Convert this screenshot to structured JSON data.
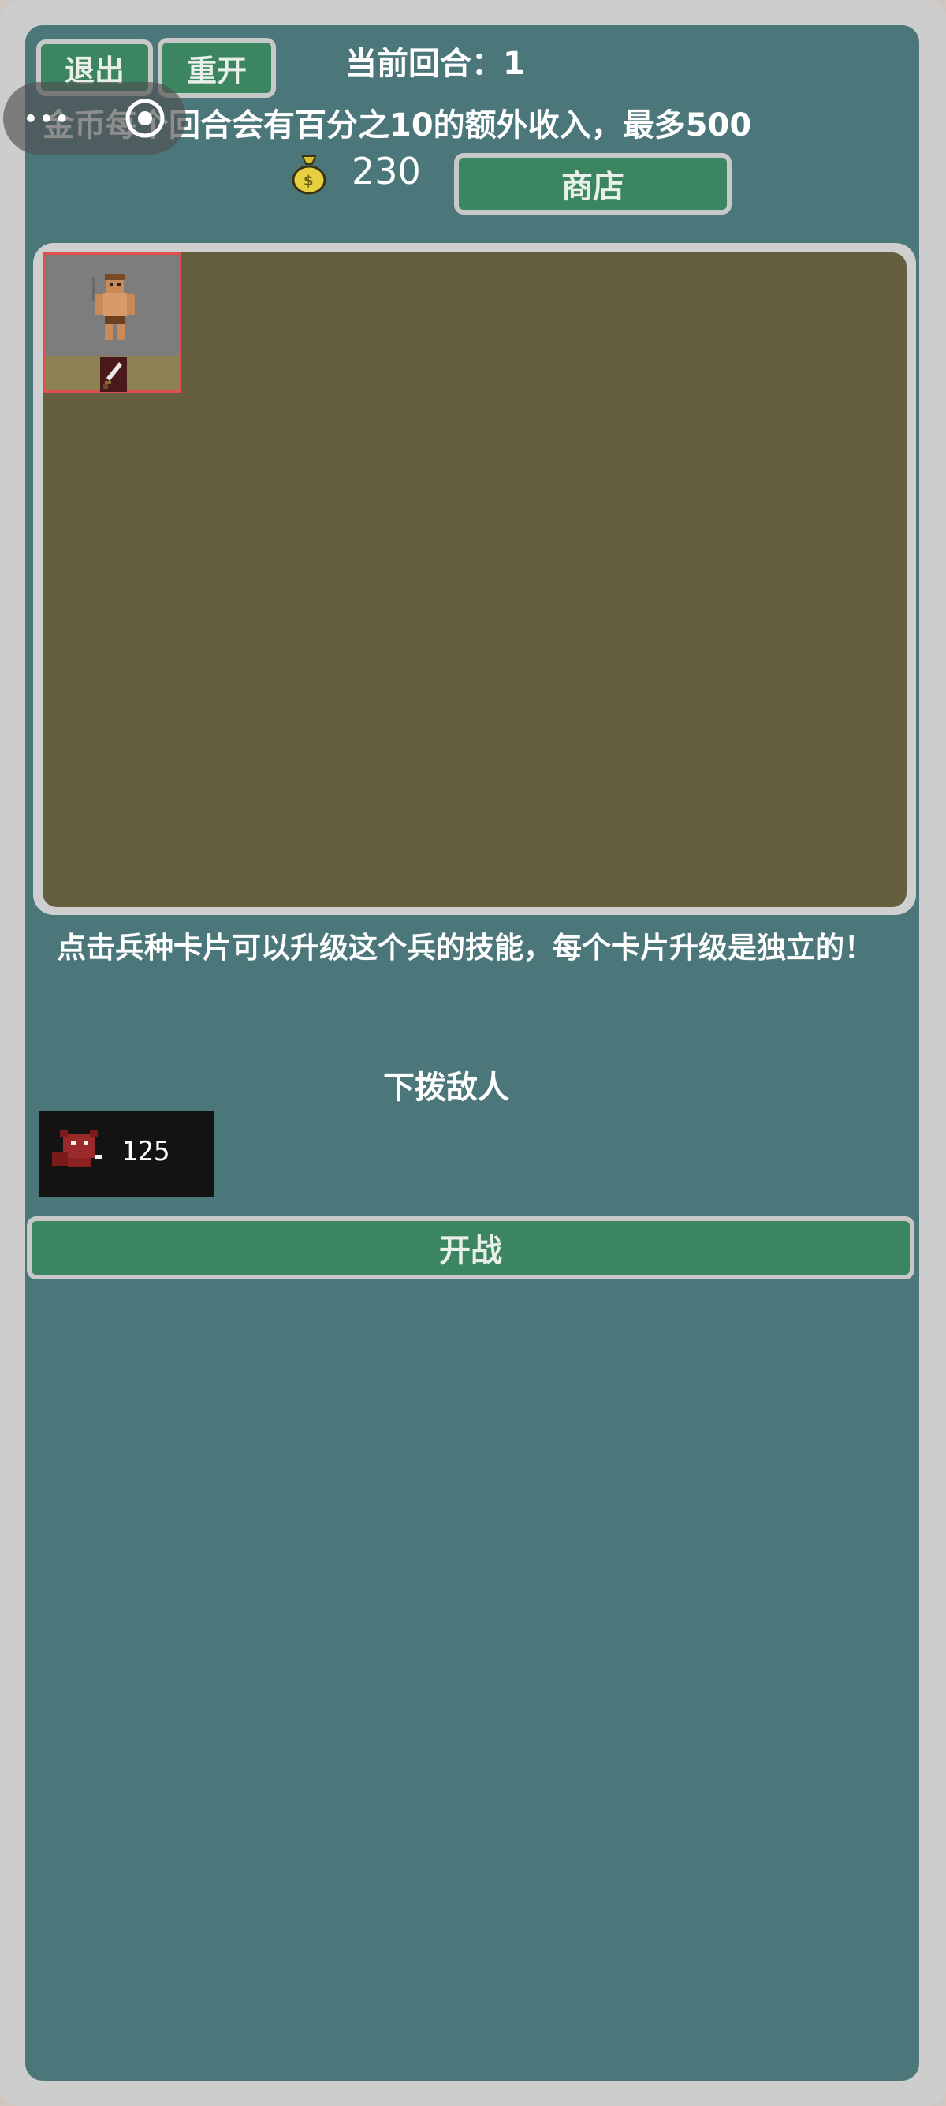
{
  "header": {
    "exit_label": "退出",
    "restart_label": "重开",
    "round_text": "当前回合：1",
    "income_info": "金币每个回合会有百分之10的额外收入，最多500",
    "gold_amount": "230",
    "shop_label": "商店"
  },
  "hint_text": "点击兵种卡片可以升级这个兵的技能，每个卡片升级是独立的！",
  "enemies": {
    "title": "下拨敌人",
    "list": [
      {
        "count": "125"
      }
    ]
  },
  "battle_label": "开战",
  "colors": {
    "background": "#4b777b",
    "button": "#3b8660",
    "board": "#655f40",
    "border": "#c8c8c8"
  },
  "icons": [
    "money-bag-icon",
    "soldier-icon",
    "sword-icon",
    "enemy-demon-icon",
    "menu-dots-icon",
    "target-icon"
  ]
}
